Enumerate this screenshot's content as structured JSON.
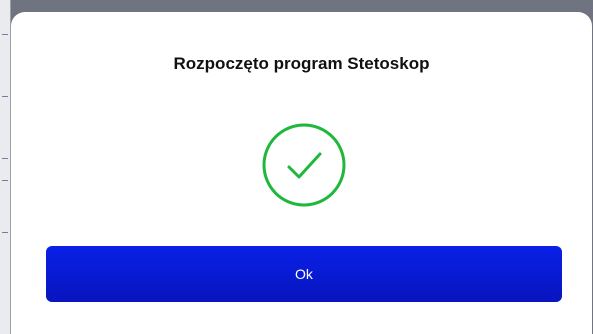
{
  "dialog": {
    "title": "Rozpoczęto program Stetoskop",
    "icon": "check-circle-icon",
    "ok_label": "Ok"
  },
  "colors": {
    "success": "#1fb83a",
    "button": "#0a1ad6",
    "button_text": "#ffffff",
    "title_text": "#111111"
  }
}
